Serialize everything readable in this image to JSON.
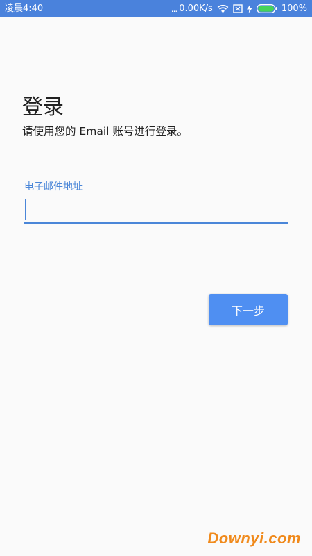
{
  "status_bar": {
    "time": "凌晨4:40",
    "network_speed": "0.00K/s",
    "battery_percent": "100%",
    "battery_level": 1.0,
    "icons": [
      "wifi-icon",
      "sim-card-icon",
      "charging-icon",
      "battery-icon"
    ],
    "background_color": "#4a82dc"
  },
  "login": {
    "title": "登录",
    "subtitle": "请使用您的 Email 账号进行登录。",
    "email_label": "电子邮件地址",
    "email_value": "",
    "next_label": "下一步",
    "accent_color": "#4a86d8",
    "button_color": "#4f8ff2"
  },
  "watermark": {
    "text": "Downyi.com",
    "color": "#f08a1c"
  }
}
